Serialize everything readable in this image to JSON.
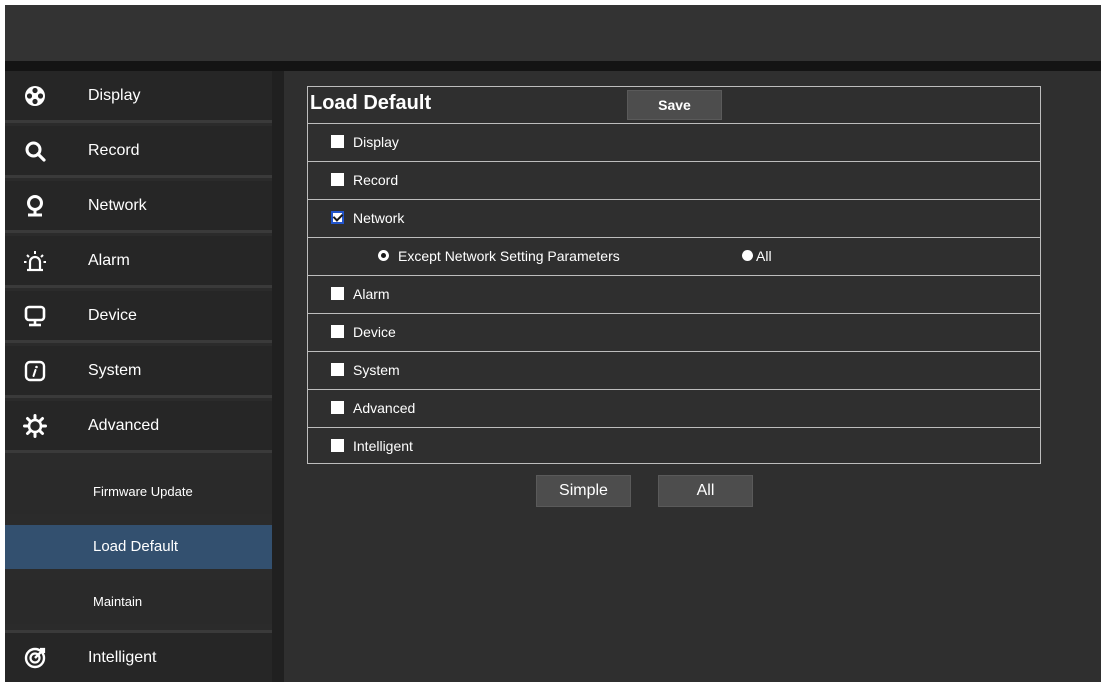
{
  "sidebar": {
    "items": [
      {
        "label": "Display",
        "icon": "display-icon"
      },
      {
        "label": "Record",
        "icon": "record-icon"
      },
      {
        "label": "Network",
        "icon": "network-icon"
      },
      {
        "label": "Alarm",
        "icon": "alarm-icon"
      },
      {
        "label": "Device",
        "icon": "device-icon"
      },
      {
        "label": "System",
        "icon": "system-icon"
      },
      {
        "label": "Advanced",
        "icon": "gear-icon"
      }
    ],
    "sub_items": [
      {
        "label": "Firmware Update",
        "active": false
      },
      {
        "label": "Load Default",
        "active": true
      },
      {
        "label": "Maintain",
        "active": false
      }
    ],
    "last_item": {
      "label": "Intelligent",
      "icon": "intelligent-icon"
    }
  },
  "main": {
    "title": "Load Default",
    "save_label": "Save",
    "options": [
      {
        "label": "Display",
        "checked": false
      },
      {
        "label": "Record",
        "checked": false
      },
      {
        "label": "Network",
        "checked": true
      }
    ],
    "network_sub": {
      "except_label": "Except Network Setting Parameters",
      "except_selected": true,
      "all_label": "All",
      "all_selected": false
    },
    "options_more": [
      {
        "label": "Alarm",
        "checked": false
      },
      {
        "label": "Device",
        "checked": false
      },
      {
        "label": "System",
        "checked": false
      },
      {
        "label": "Advanced",
        "checked": false
      },
      {
        "label": "Intelligent",
        "checked": false
      }
    ],
    "simple_label": "Simple",
    "all_label": "All"
  },
  "colors": {
    "background": "#2f2f2f",
    "active_item": "#33506f",
    "button": "#4d4d4d",
    "border": "#bdbdbd"
  }
}
